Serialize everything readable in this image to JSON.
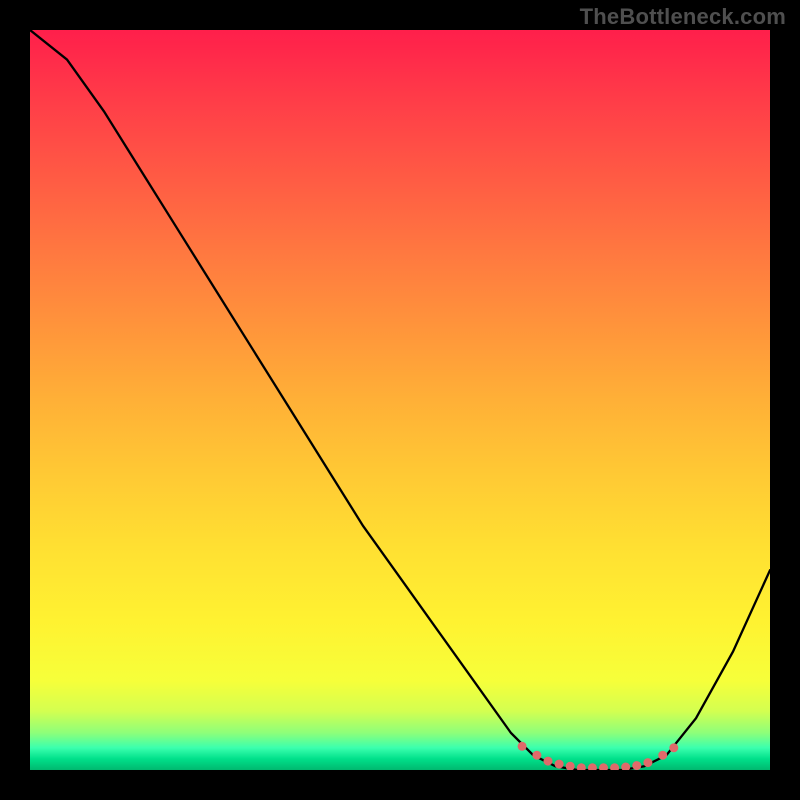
{
  "watermark": "TheBottleneck.com",
  "chart_data": {
    "type": "line",
    "title": "",
    "xlabel": "",
    "ylabel": "",
    "xlim": [
      0,
      1
    ],
    "ylim": [
      0,
      1
    ],
    "series": [
      {
        "name": "curve",
        "x": [
          0.0,
          0.05,
          0.1,
          0.15,
          0.2,
          0.25,
          0.3,
          0.35,
          0.4,
          0.45,
          0.5,
          0.55,
          0.6,
          0.65,
          0.68,
          0.71,
          0.74,
          0.77,
          0.8,
          0.83,
          0.86,
          0.9,
          0.95,
          1.0
        ],
        "y": [
          1.0,
          0.96,
          0.89,
          0.81,
          0.73,
          0.65,
          0.57,
          0.49,
          0.41,
          0.33,
          0.26,
          0.19,
          0.12,
          0.05,
          0.02,
          0.005,
          0.0,
          0.0,
          0.0,
          0.005,
          0.02,
          0.07,
          0.16,
          0.27
        ]
      },
      {
        "name": "trough-dots",
        "x": [
          0.665,
          0.685,
          0.7,
          0.715,
          0.73,
          0.745,
          0.76,
          0.775,
          0.79,
          0.805,
          0.82,
          0.835,
          0.855,
          0.87
        ],
        "y": [
          0.032,
          0.02,
          0.012,
          0.008,
          0.005,
          0.003,
          0.003,
          0.003,
          0.003,
          0.004,
          0.006,
          0.01,
          0.02,
          0.03
        ]
      }
    ],
    "gradient_stops": [
      {
        "pos": 0.0,
        "color": "#ff1f4b"
      },
      {
        "pos": 0.5,
        "color": "#ffb037"
      },
      {
        "pos": 0.88,
        "color": "#f6ff3a"
      },
      {
        "pos": 1.0,
        "color": "#00b86f"
      }
    ]
  }
}
